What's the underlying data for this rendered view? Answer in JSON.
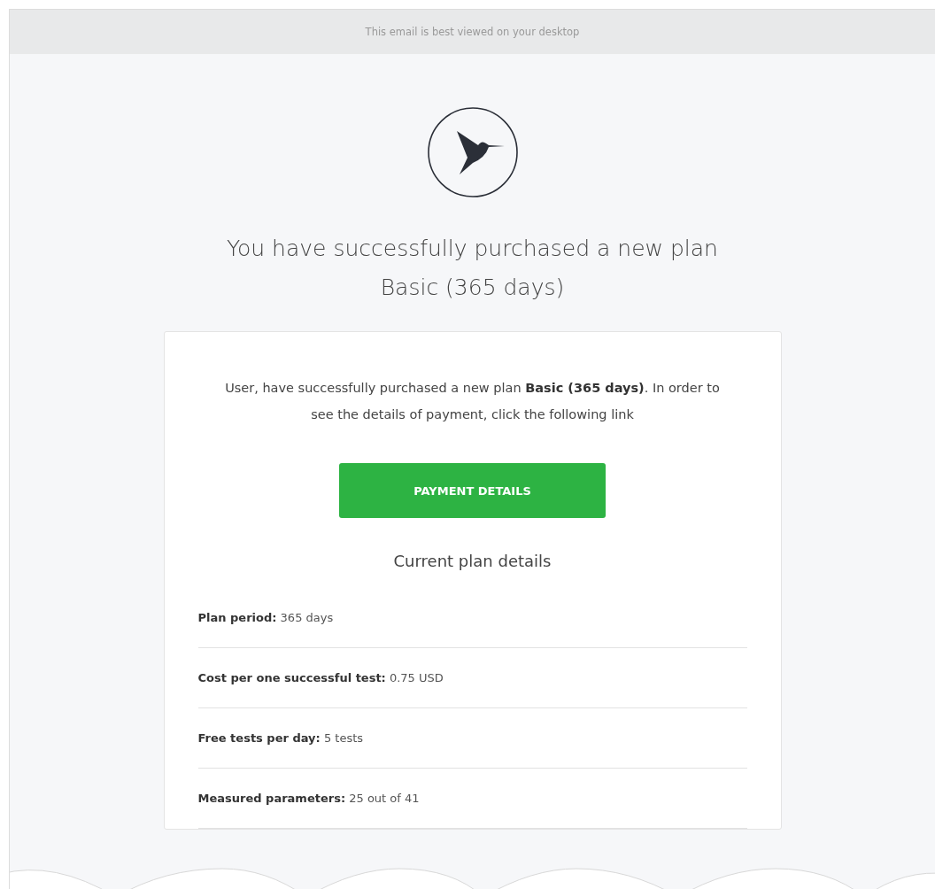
{
  "banner": {
    "text": "This email is best viewed on your desktop"
  },
  "headline": [
    "You have successfully purchased a new plan",
    "Basic (365 days)"
  ],
  "card": {
    "message": "User, have successfully purchased a new plan **Basic (365 days)**. In order to see the details of payment, click the following link",
    "button": "PAYMENT DETAILS",
    "details_title": "Current plan details",
    "details": [
      {
        "text": "**Plan period:** 365 days"
      },
      {
        "text": "**Cost per one successful test:** 0.75 USD"
      },
      {
        "text": "**Free tests per day:** 5 tests"
      },
      {
        "text": "**Measured parameters:** 25 out of 41"
      }
    ]
  }
}
